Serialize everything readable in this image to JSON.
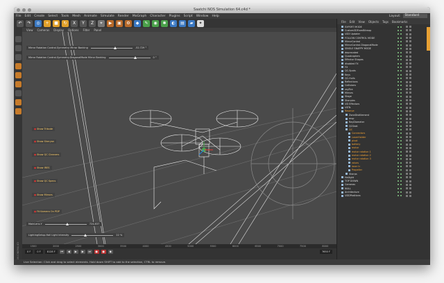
{
  "window": {
    "title": "Saatchi NOS Simulation 64.c4d *"
  },
  "menu": [
    "File",
    "Edit",
    "Create",
    "Select",
    "Tools",
    "Mesh",
    "Animate",
    "Simulate",
    "Render",
    "MoGraph",
    "Character",
    "Plugins",
    "Script",
    "Window",
    "Help"
  ],
  "layout": {
    "label": "Layout:",
    "value": "Standard"
  },
  "viewport": {
    "menu": [
      "View",
      "Cameras",
      "Display",
      "Options",
      "Filter",
      "Panel"
    ],
    "label": "Perspective",
    "sliders": [
      {
        "label": "Mirror Rotation Control.Symmetry Mirror Banking",
        "value": "-52.729 °",
        "fraction": 0.55
      },
      {
        "label": "Mirror Rotation Control.Symmetry.DiagonalMode Mirror Banking",
        "value": "0 °",
        "fraction": 0.6
      },
      {
        "label": "MainLens.Y",
        "value": "724.837",
        "fraction": 0.5
      },
      {
        "label": "LightingSetup.Hall Light Intensity",
        "value": "22 %",
        "fraction": 0.3
      }
    ],
    "buttons": [
      "Show Trikode",
      "Show Sheryan",
      "Show QC Cleaners",
      "Show IRES",
      "Show QC Specs",
      "Show Mirrors",
      "Fit Kamera On PDP"
    ]
  },
  "timeline": {
    "ticks": [
      "1500",
      "2000",
      "2500",
      "3000",
      "3500",
      "4000",
      "4500",
      "5000",
      "5500",
      "6000",
      "6500",
      "7000",
      "7500",
      "8000"
    ],
    "current": "0 F",
    "start": "0 F",
    "end": "8128 F",
    "frame_right": "7650 F"
  },
  "status": "Live Selection: Click and drag to select elements. Hold down SHIFT to add to the selection, CTRL to remove.",
  "objects": {
    "menu": [
      "File",
      "Edit",
      "View",
      "Objects",
      "Tags",
      "Bookmarks"
    ],
    "items": [
      {
        "name": "EXPORT MODE",
        "orange": false
      },
      {
        "name": "Custom3DFromBitmap",
        "orange": false
      },
      {
        "name": "UD3 Updater",
        "orange": false
      },
      {
        "name": "FOLLOW CONTROL MODE",
        "orange": false
      },
      {
        "name": "MirrorControl",
        "orange": false
      },
      {
        "name": "MirrorControl.DiagonalMode",
        "orange": false
      },
      {
        "name": "SINGLE SNAPPY MODE",
        "orange": false
      },
      {
        "name": "deprecated",
        "orange": false
      },
      {
        "name": "Quadcopters",
        "orange": false
      },
      {
        "name": "Effector Shapes",
        "orange": false
      },
      {
        "name": "disabled FX",
        "orange": false
      },
      {
        "name": "FX",
        "orange": false
      },
      {
        "name": "QC-Spots",
        "orange": false
      },
      {
        "name": "Keys",
        "orange": false
      },
      {
        "name": "QC-Hulls",
        "orange": false
      },
      {
        "name": "Reflections",
        "orange": false
      },
      {
        "name": "Collisions",
        "orange": false
      },
      {
        "name": "rayFire",
        "orange": false
      },
      {
        "name": "Mirrors",
        "orange": false
      },
      {
        "name": "Stage",
        "orange": false
      },
      {
        "name": "Sharpies",
        "orange": false
      },
      {
        "name": "UD Effectors",
        "orange": false
      },
      {
        "name": "UDTs",
        "orange": false
      },
      {
        "name": "Reserve",
        "orange": true
      },
      {
        "name": "ZoneDistillement",
        "orange": false
      },
      {
        "name": "mvp",
        "orange": false
      },
      {
        "name": "RayDiameter",
        "orange": false
      },
      {
        "name": "QCSeat",
        "orange": false
      },
      {
        "name": "QC",
        "orange": true
      },
      {
        "name": "Connectors",
        "orange": true
      },
      {
        "name": "LaserHolder",
        "orange": true
      },
      {
        "name": "pivot",
        "orange": true
      },
      {
        "name": "battery",
        "orange": true
      },
      {
        "name": "motor",
        "orange": true
      },
      {
        "name": "motor rotation 1",
        "orange": true
      },
      {
        "name": "motor rotation 2",
        "orange": true
      },
      {
        "name": "motor rotation 3",
        "orange": true
      },
      {
        "name": "rotors",
        "orange": true
      },
      {
        "name": "laser tr",
        "orange": true
      },
      {
        "name": "Propeller",
        "orange": true
      },
      {
        "name": "Sharps",
        "orange": false
      },
      {
        "name": "Hallight",
        "orange": false
      },
      {
        "name": "TOP DOWN",
        "orange": false
      },
      {
        "name": "Cameras",
        "orange": false
      },
      {
        "name": "NULL",
        "orange": false
      },
      {
        "name": "Architecture",
        "orange": false
      },
      {
        "name": "UDDPositions",
        "orange": false
      }
    ]
  }
}
